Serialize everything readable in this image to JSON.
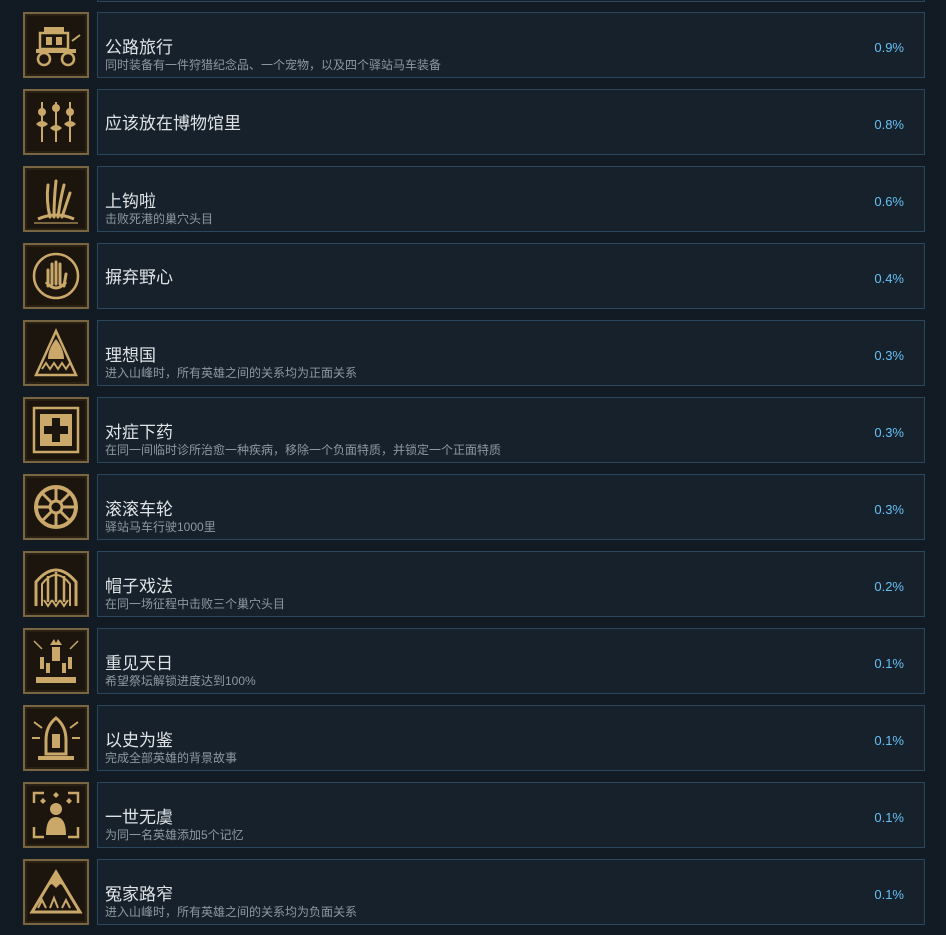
{
  "colors": {
    "background": "#121a23",
    "row_border": "#2a475e",
    "title": "#dfe3e6",
    "description": "#8f98a0",
    "percent": "#66c0f4",
    "icon_gold": "#c9a86a"
  },
  "achievements": [
    {
      "title": "公路旅行",
      "description": "同时装备有一件狩猎纪念品、一个宠物，以及四个驿站马车装备",
      "percent": "0.9%",
      "icon": "stagecoach-icon"
    },
    {
      "title": "应该放在博物馆里",
      "description": "",
      "percent": "0.8%",
      "icon": "museum-relics-icon"
    },
    {
      "title": "上钩啦",
      "description": "击败死港的巢穴头目",
      "percent": "0.6%",
      "icon": "tentacle-hand-icon"
    },
    {
      "title": "摒弃野心",
      "description": "",
      "percent": "0.4%",
      "icon": "open-palm-icon"
    },
    {
      "title": "理想国",
      "description": "进入山峰时，所有英雄之间的关系均为正面关系",
      "percent": "0.3%",
      "icon": "hooded-figure-icon"
    },
    {
      "title": "对症下药",
      "description": "在同一间临时诊所治愈一种疾病，移除一个负面特质，并锁定一个正面特质",
      "percent": "0.3%",
      "icon": "medical-cross-icon"
    },
    {
      "title": "滚滚车轮",
      "description": "驿站马车行驶1000里",
      "percent": "0.3%",
      "icon": "wagon-wheel-icon"
    },
    {
      "title": "帽子戏法",
      "description": "在同一场征程中击败三个巢穴头目",
      "percent": "0.2%",
      "icon": "triple-sword-arch-icon"
    },
    {
      "title": "重见天日",
      "description": "希望祭坛解锁进度达到100%",
      "percent": "0.1%",
      "icon": "altar-candles-icon"
    },
    {
      "title": "以史为鉴",
      "description": "完成全部英雄的背景故事",
      "percent": "0.1%",
      "icon": "radiant-shrine-icon"
    },
    {
      "title": "一世无虞",
      "description": "为同一名英雄添加5个记忆",
      "percent": "0.1%",
      "icon": "memory-figure-icon"
    },
    {
      "title": "冤家路窄",
      "description": "进入山峰时，所有英雄之间的关系均为负面关系",
      "percent": "0.1%",
      "icon": "mountain-peak-icon"
    }
  ]
}
